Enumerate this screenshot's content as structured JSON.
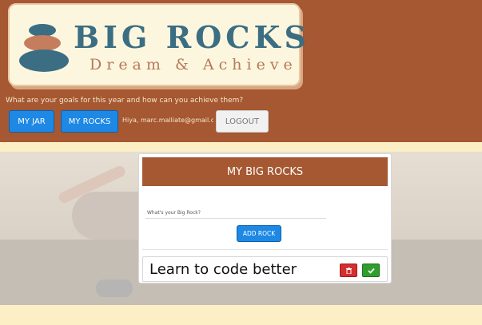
{
  "header": {
    "logo": {
      "title": "BIG ROCKS",
      "subtitle": "Dream & Achieve",
      "icon": "stacked-stones-icon"
    },
    "tagline": "What are your goals for this year and how can you achieve them?",
    "nav": {
      "my_jar": "MY JAR",
      "my_rocks": "MY ROCKS",
      "logout": "LOGOUT"
    },
    "greeting": "Hiya, marc.malliate@gmail.co!"
  },
  "panel": {
    "title": "MY BIG ROCKS",
    "input_label": "What's your Big Rock?",
    "add_button": "ADD ROCK",
    "rocks": [
      {
        "text": "Learn to code better",
        "delete_icon": "trash-icon",
        "done_icon": "check-icon"
      }
    ]
  },
  "colors": {
    "header_bg": "#a55831",
    "page_bg": "#fcefc6",
    "logo_text": "#3b6e83",
    "primary_button": "#1e88e5",
    "delete_button": "#d32f2f",
    "done_button": "#2e9f2e"
  }
}
